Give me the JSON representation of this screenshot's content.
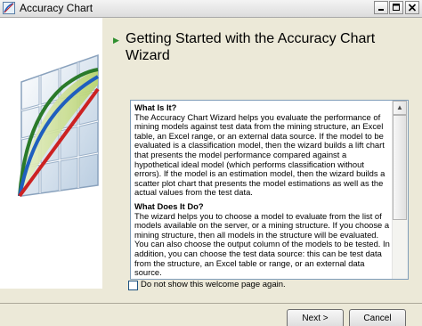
{
  "window": {
    "title": "Accuracy Chart",
    "controls": {
      "minimize": "minimize",
      "maximize": "maximize",
      "close": "close"
    }
  },
  "header": {
    "title": "Getting Started with the Accuracy Chart Wizard"
  },
  "info": {
    "sections": [
      {
        "title": "What Is It?",
        "body": "The Accuracy Chart Wizard helps you evaluate the performance of mining models against test data from the mining structure, an Excel table, an Excel range, or an external data source. If the model to be evaluated is a classification model, then the wizard builds a lift chart that presents the model performance compared against a hypothetical ideal model (which performs classification without errors). If the model is an estimation model, then the wizard builds a scatter plot chart that presents the model estimations as well as the actual values from the test data."
      },
      {
        "title": "What Does It Do?",
        "body": "The wizard helps you to choose a model to evaluate from the list of models available on the server, or a mining structure. If you choose a mining structure, then all models in the structure will be evaluated. You can also choose the output column of the models to be tested. In addition, you can choose the test data source: this can be test data from the structure, an Excel table or range, or an external data source."
      }
    ]
  },
  "footer": {
    "checkbox_label": "Do not show this welcome page again.",
    "checkbox_checked": false,
    "next_label": "Next >",
    "cancel_label": "Cancel"
  },
  "colors": {
    "ideal_line": "#2a7a2a",
    "model_line": "#1f5fbf",
    "random_line": "#cc2222",
    "arrow": "#2f8f2f"
  },
  "icons": {
    "app": "chart-icon",
    "arrow": "right-triangle-icon"
  }
}
